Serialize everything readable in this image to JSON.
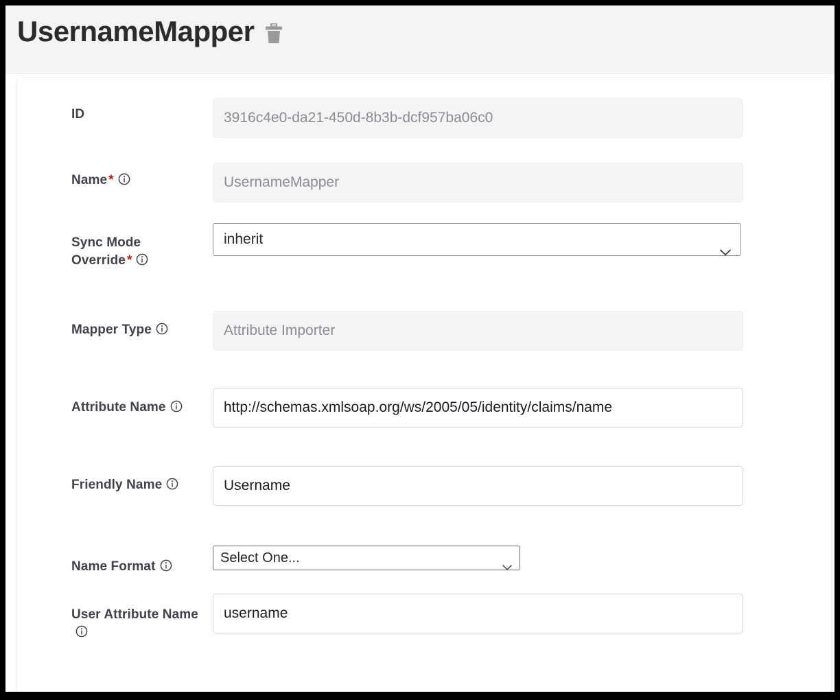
{
  "header": {
    "title": "UsernameMapper",
    "delete_icon": "trash-icon"
  },
  "form": {
    "fields": [
      {
        "key": "id",
        "label": "ID",
        "required": false,
        "has_info": false,
        "control": "text",
        "value": "3916c4e0-da21-450d-8b3b-dcf957ba06c0",
        "disabled": true
      },
      {
        "key": "name",
        "label": "Name",
        "required": true,
        "has_info": true,
        "control": "text",
        "value": "UsernameMapper",
        "disabled": true
      },
      {
        "key": "sync_mode_override",
        "label": "Sync Mode Override",
        "required": true,
        "has_info": true,
        "control": "select",
        "value": "inherit",
        "disabled": false
      },
      {
        "key": "mapper_type",
        "label": "Mapper Type",
        "required": false,
        "has_info": true,
        "control": "text",
        "value": "Attribute Importer",
        "disabled": true
      },
      {
        "key": "attribute_name",
        "label": "Attribute Name",
        "required": false,
        "has_info": true,
        "control": "text",
        "value": "http://schemas.xmlsoap.org/ws/2005/05/identity/claims/name",
        "disabled": false
      },
      {
        "key": "friendly_name",
        "label": "Friendly Name",
        "required": false,
        "has_info": true,
        "control": "text",
        "value": "Username",
        "disabled": false
      },
      {
        "key": "name_format",
        "label": "Name Format",
        "required": false,
        "has_info": true,
        "control": "select-narrow",
        "value": "Select One...",
        "disabled": false
      },
      {
        "key": "user_attribute_name",
        "label": "User Attribute Name",
        "required": false,
        "has_info": true,
        "control": "text",
        "value": "username",
        "disabled": false
      }
    ]
  },
  "icons": {
    "info": "info-circle-icon",
    "chevron": "chevron-down-icon",
    "trash": "trash-icon"
  },
  "colors": {
    "required_asterisk": "#c9190b",
    "label": "#42424f",
    "disabled_text": "#8b8b95",
    "header_bg": "#f4f4f4"
  }
}
